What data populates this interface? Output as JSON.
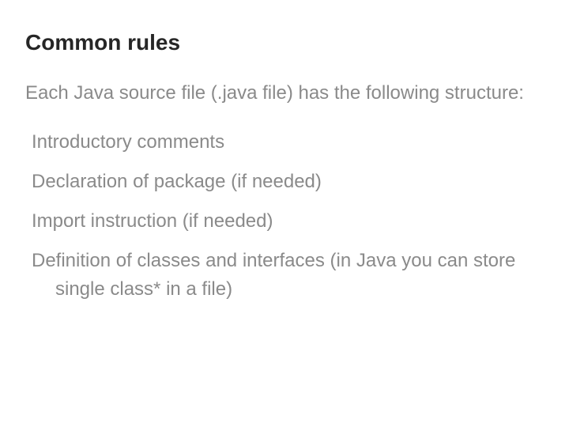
{
  "heading": "Common rules",
  "intro": "Each Java source file (.java file) has the following structure:",
  "items": [
    "Introductory comments",
    "Declaration of package (if needed)",
    "Import instruction (if needed)",
    "Definition of classes and interfaces (in Java you can store single class* in a file)"
  ]
}
